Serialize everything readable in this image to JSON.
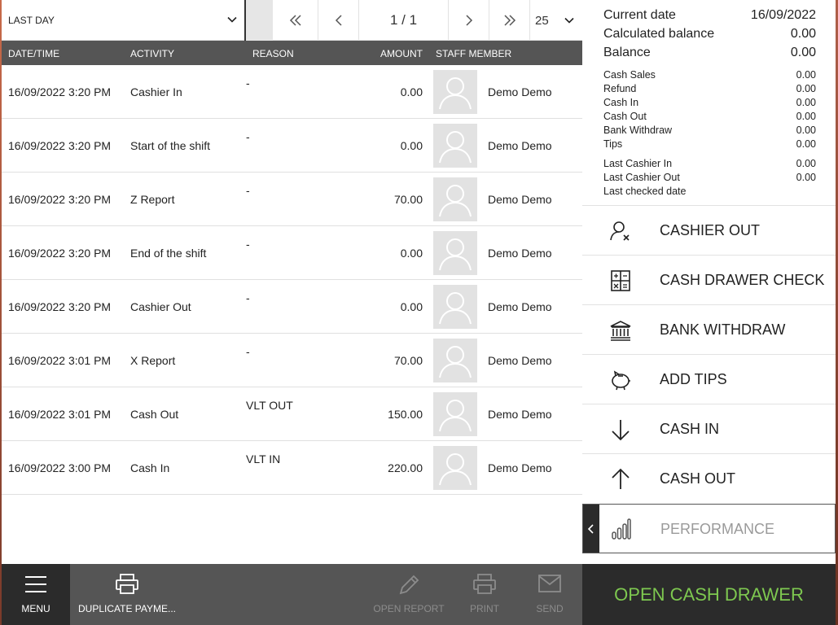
{
  "filter": {
    "period": "LAST DAY"
  },
  "pager": {
    "page_info": "1 / 1",
    "page_size": "25"
  },
  "table": {
    "headers": {
      "datetime": "DATE/TIME",
      "activity": "ACTIVITY",
      "reason": "REASON",
      "amount": "AMOUNT",
      "staff": "STAFF MEMBER"
    },
    "rows": [
      {
        "datetime": "16/09/2022 3:20 PM",
        "activity": "Cashier In",
        "reason": "-",
        "amount": "0.00",
        "staff": "Demo Demo"
      },
      {
        "datetime": "16/09/2022 3:20 PM",
        "activity": "Start of the shift",
        "reason": "-",
        "amount": "0.00",
        "staff": "Demo Demo"
      },
      {
        "datetime": "16/09/2022 3:20 PM",
        "activity": "Z Report",
        "reason": "-",
        "amount": "70.00",
        "staff": "Demo Demo"
      },
      {
        "datetime": "16/09/2022 3:20 PM",
        "activity": "End of the shift",
        "reason": "-",
        "amount": "0.00",
        "staff": "Demo Demo"
      },
      {
        "datetime": "16/09/2022 3:20 PM",
        "activity": "Cashier Out",
        "reason": "-",
        "amount": "0.00",
        "staff": "Demo Demo"
      },
      {
        "datetime": "16/09/2022 3:01 PM",
        "activity": "X Report",
        "reason": "-",
        "amount": "70.00",
        "staff": "Demo Demo"
      },
      {
        "datetime": "16/09/2022 3:01 PM",
        "activity": "Cash Out",
        "reason": "VLT OUT",
        "amount": "150.00",
        "staff": "Demo Demo"
      },
      {
        "datetime": "16/09/2022 3:00 PM",
        "activity": "Cash In",
        "reason": "VLT IN",
        "amount": "220.00",
        "staff": "Demo Demo"
      }
    ]
  },
  "summary": {
    "current_date_label": "Current date",
    "current_date": "16/09/2022",
    "calc_balance_label": "Calculated balance",
    "calc_balance": "0.00",
    "balance_label": "Balance",
    "balance": "0.00",
    "details": [
      {
        "label": "Cash Sales",
        "value": "0.00"
      },
      {
        "label": "Refund",
        "value": "0.00"
      },
      {
        "label": "Cash In",
        "value": "0.00"
      },
      {
        "label": "Cash Out",
        "value": "0.00"
      },
      {
        "label": "Bank Withdraw",
        "value": "0.00"
      },
      {
        "label": "Tips",
        "value": "0.00"
      }
    ],
    "last": [
      {
        "label": "Last Cashier In",
        "value": "0.00"
      },
      {
        "label": "Last Cashier Out",
        "value": "0.00"
      },
      {
        "label": "Last checked date",
        "value": ""
      }
    ]
  },
  "actions": {
    "cashier_out": "CASHIER OUT",
    "cash_drawer_check": "CASH DRAWER CHECK",
    "bank_withdraw": "BANK WITHDRAW",
    "add_tips": "ADD TIPS",
    "cash_in": "CASH IN",
    "cash_out": "CASH OUT",
    "performance": "PERFORMANCE"
  },
  "bottombar": {
    "menu": "MENU",
    "duplicate_payment": "DUPLICATE PAYME...",
    "open_report": "OPEN REPORT",
    "print": "PRINT",
    "send": "SEND"
  },
  "open_cash_drawer": "OPEN CASH DRAWER",
  "colors": {
    "accent_green": "#7ec850",
    "header_gray": "#555555",
    "dark": "#2b2b2b"
  }
}
